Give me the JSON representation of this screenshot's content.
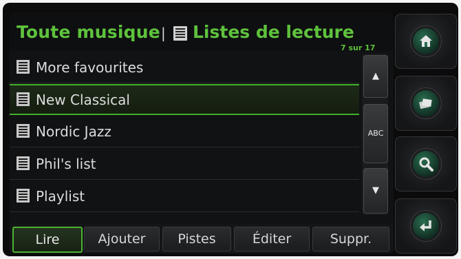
{
  "header": {
    "all_music": "Toute musique",
    "separator": "|",
    "playlists": "Listes de lecture",
    "counter": "7 sur 17"
  },
  "list": {
    "items": [
      {
        "label": "More favourites"
      },
      {
        "label": "New Classical",
        "selected": true
      },
      {
        "label": "Nordic Jazz"
      },
      {
        "label": "Phil's list"
      },
      {
        "label": "Playlist"
      }
    ]
  },
  "scrollbar": {
    "up": "▲",
    "abc": "ABC",
    "down": "▼"
  },
  "tabs": [
    {
      "label": "Lire",
      "active": true
    },
    {
      "label": "Ajouter"
    },
    {
      "label": "Pistes"
    },
    {
      "label": "Éditer"
    },
    {
      "label": "Suppr."
    }
  ],
  "side_buttons": [
    {
      "icon": "home-icon"
    },
    {
      "icon": "media-source-icon"
    },
    {
      "icon": "search-icon"
    },
    {
      "icon": "back-enter-icon"
    }
  ],
  "colors": {
    "accent": "#5ec23d",
    "selection_border": "#3fb22a",
    "background": "#111214"
  }
}
